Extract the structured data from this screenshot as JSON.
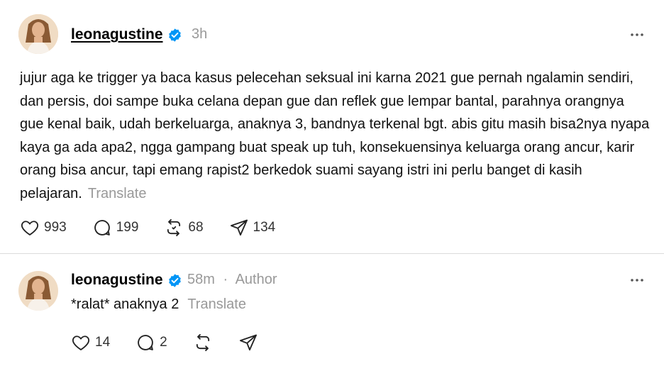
{
  "post": {
    "username": "leonagustine",
    "time": "3h",
    "text": "jujur aga ke trigger ya baca kasus pelecehan seksual ini karna 2021 gue pernah ngalamin sendiri, dan persis, doi sampe buka celana depan gue dan reflek gue lempar bantal, parahnya orangnya gue kenal baik, udah berkeluarga, anaknya 3, bandnya terkenal bgt. abis gitu masih bisa2nya nyapa kaya ga ada apa2, ngga gampang buat speak up tuh, konsekuensinya keluarga orang ancur, karir orang bisa ancur, tapi emang rapist2 berkedok suami sayang istri ini perlu banget di kasih pelajaran.",
    "translate_label": "Translate",
    "likes": "993",
    "replies": "199",
    "reposts": "68",
    "shares": "134"
  },
  "reply": {
    "username": "leonagustine",
    "time": "58m",
    "separator": "·",
    "author_label": "Author",
    "text": "*ralat* anaknya 2",
    "translate_label": "Translate",
    "likes": "14",
    "replies": "2"
  },
  "colors": {
    "verified": "#0095f6",
    "muted": "#999999",
    "divider": "#dcdcdc"
  },
  "icons": [
    "verified-badge-icon",
    "more-icon",
    "heart-icon",
    "comment-icon",
    "repost-icon",
    "share-icon"
  ]
}
